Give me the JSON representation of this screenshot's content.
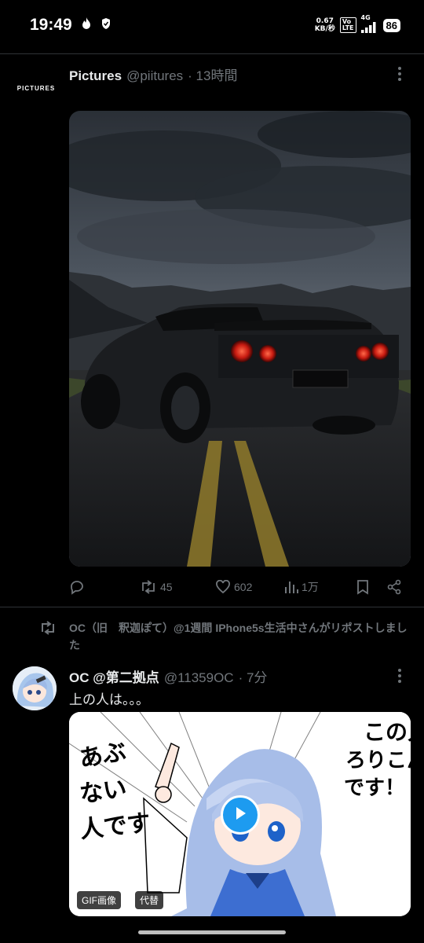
{
  "status_bar": {
    "time": "19:49",
    "net_speed_value": "0.67",
    "net_speed_unit": "KB/秒",
    "volte_top": "Vo",
    "volte_bottom": "LTE",
    "network": "4G",
    "battery": "86"
  },
  "tweet1": {
    "avatar_text": "PICTURES",
    "name": "Pictures",
    "handle": "@piitures",
    "time": "· 13時間",
    "actions": {
      "retweets": "45",
      "likes": "602",
      "views": "1万"
    }
  },
  "retweet_notice": {
    "text": "OC（旧　釈迦ぽて）@1週間 IPhone5s生活中さんがリポストしました"
  },
  "tweet2": {
    "name": "OC @第二拠点",
    "handle": "@11359OC",
    "time": "· 7分",
    "text": "上の人は。。。",
    "badge_gif": "GIF画像",
    "badge_alt": "代替",
    "manga_right_text": "この人ろりこんです！",
    "manga_left_text": "あぶない人です"
  },
  "colors": {
    "background": "#000000",
    "text": "#e7e9ea",
    "muted": "#71767b",
    "accent": "#1d9bf0"
  },
  "icons": [
    "fire-icon",
    "shield-icon",
    "signal-icon",
    "more-icon",
    "reply-icon",
    "retweet-icon",
    "like-icon",
    "views-icon",
    "bookmark-icon",
    "share-icon",
    "play-icon"
  ]
}
